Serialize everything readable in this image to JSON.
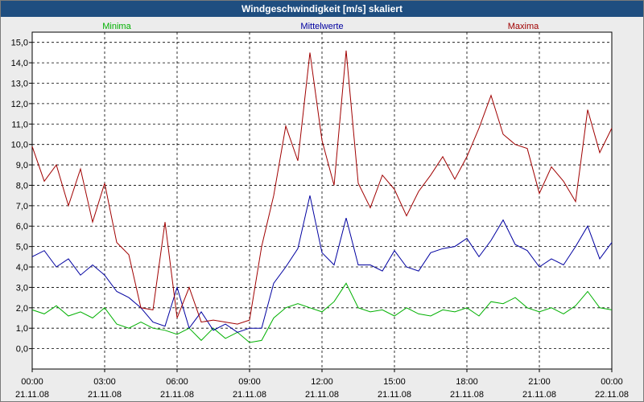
{
  "window": {
    "title": "Windgeschwindigkeit [m/s] skaliert"
  },
  "chart_data": {
    "type": "line",
    "title": "Windgeschwindigkeit [m/s] skaliert",
    "xlabel": "",
    "ylabel": "",
    "ylim": [
      -1,
      15.5
    ],
    "xlim": [
      0,
      24
    ],
    "yticks": [
      "0,0",
      "1,0",
      "2,0",
      "3,0",
      "4,0",
      "5,0",
      "6,0",
      "7,0",
      "8,0",
      "9,0",
      "10,0",
      "11,0",
      "12,0",
      "13,0",
      "14,0",
      "15,0"
    ],
    "xticks": [
      {
        "time": "00:00",
        "date": "21.11.08"
      },
      {
        "time": "03:00",
        "date": "21.11.08"
      },
      {
        "time": "06:00",
        "date": "21.11.08"
      },
      {
        "time": "09:00",
        "date": "21.11.08"
      },
      {
        "time": "12:00",
        "date": "21.11.08"
      },
      {
        "time": "15:00",
        "date": "21.11.08"
      },
      {
        "time": "18:00",
        "date": "21.11.08"
      },
      {
        "time": "21:00",
        "date": "21.11.08"
      },
      {
        "time": "00:00",
        "date": "22.11.08"
      }
    ],
    "grid": true,
    "legend_position": "top",
    "x_hours": [
      0,
      0.5,
      1,
      1.5,
      2,
      2.5,
      3,
      3.5,
      4,
      4.5,
      5,
      5.5,
      6,
      6.5,
      7,
      7.5,
      8,
      8.5,
      9,
      9.5,
      10,
      10.5,
      11,
      11.5,
      12,
      12.5,
      13,
      13.5,
      14,
      14.5,
      15,
      15.5,
      16,
      16.5,
      17,
      17.5,
      18,
      18.5,
      19,
      19.5,
      20,
      20.5,
      21,
      21.5,
      22,
      22.5,
      23,
      23.5,
      24
    ],
    "series": [
      {
        "name": "Minima",
        "color": "#00b000",
        "values": [
          1.9,
          1.7,
          2.1,
          1.6,
          1.8,
          1.5,
          2.0,
          1.2,
          1.0,
          1.3,
          1.0,
          0.9,
          0.7,
          1.0,
          0.4,
          1.0,
          0.5,
          0.8,
          0.3,
          0.4,
          1.5,
          2.0,
          2.2,
          2.0,
          1.8,
          2.3,
          3.2,
          2.0,
          1.8,
          1.9,
          1.6,
          2.0,
          1.7,
          1.6,
          1.9,
          1.8,
          2.0,
          1.6,
          2.3,
          2.2,
          2.5,
          2.0,
          1.8,
          2.0,
          1.7,
          2.1,
          2.8,
          2.0,
          1.9
        ]
      },
      {
        "name": "Mittelwerte",
        "color": "#0000a0",
        "values": [
          4.5,
          4.8,
          4.0,
          4.4,
          3.6,
          4.1,
          3.6,
          2.8,
          2.5,
          2.0,
          1.3,
          1.1,
          3.0,
          1.0,
          1.8,
          0.9,
          1.2,
          0.8,
          1.0,
          1.0,
          3.2,
          4.0,
          4.9,
          7.5,
          4.7,
          4.1,
          6.4,
          4.1,
          4.1,
          3.8,
          4.8,
          4.0,
          3.8,
          4.7,
          4.9,
          5.0,
          5.4,
          4.5,
          5.3,
          6.3,
          5.1,
          4.8,
          4.0,
          4.4,
          4.1,
          5.0,
          6.0,
          4.4,
          5.2
        ]
      },
      {
        "name": "Maxima",
        "color": "#a00000",
        "values": [
          9.9,
          8.2,
          9.0,
          7.0,
          8.8,
          6.2,
          8.1,
          5.2,
          4.6,
          2.0,
          1.9,
          6.2,
          1.5,
          3.0,
          1.3,
          1.4,
          1.3,
          1.2,
          1.4,
          5.0,
          7.5,
          10.9,
          9.2,
          14.5,
          10.2,
          8.0,
          14.6,
          8.1,
          6.9,
          8.5,
          7.8,
          6.5,
          7.7,
          8.5,
          9.4,
          8.3,
          9.4,
          10.8,
          12.4,
          10.5,
          10.0,
          9.8,
          7.6,
          8.9,
          8.2,
          7.2,
          11.7,
          9.6,
          10.8
        ]
      }
    ]
  }
}
